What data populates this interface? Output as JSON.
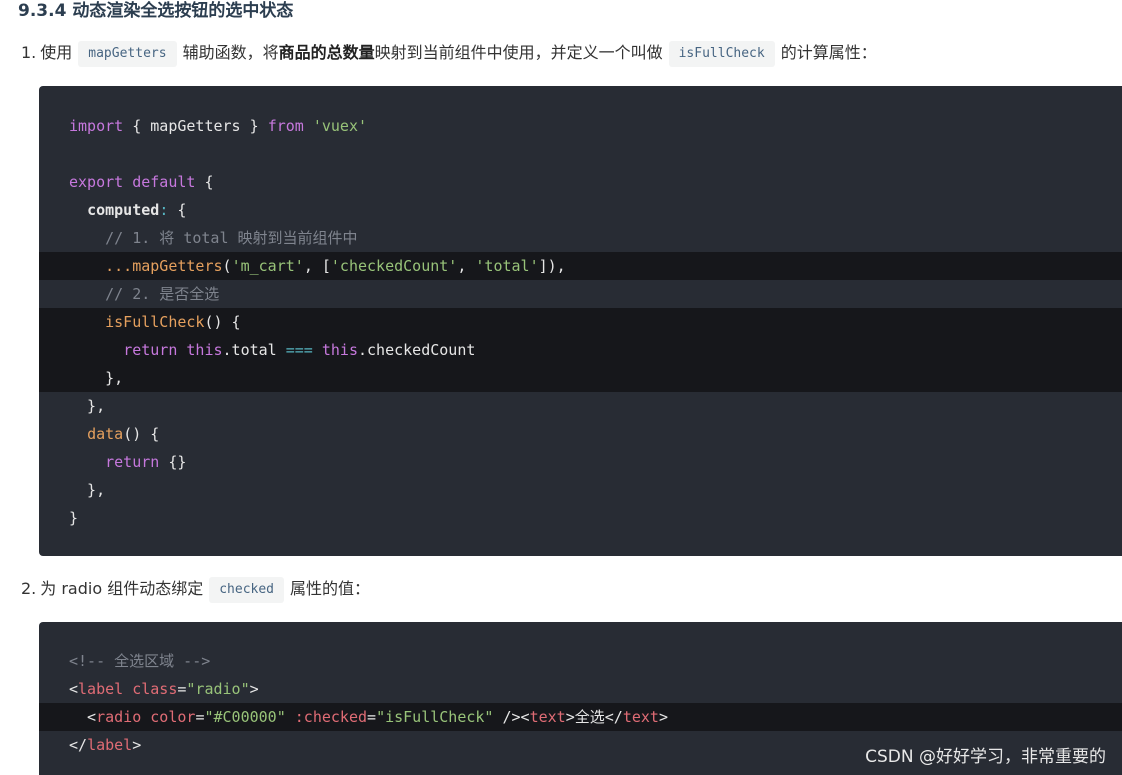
{
  "heading": "9.3.4 动态渲染全选按钮的选中状态",
  "step1": {
    "num": "1.",
    "t1": "使用",
    "code1": "mapGetters",
    "t2": "辅助函数，将",
    "bold": "商品的总数量",
    "t3": "映射到当前组件中使用，并定义一个叫做",
    "code2": "isFullCheck",
    "t4": "的计算属性："
  },
  "code1": {
    "l1": {
      "a": "import",
      "b": " { mapGetters } ",
      "c": "from",
      "d": " ",
      "e": "'vuex'"
    },
    "l3": {
      "a": "export",
      "b": " ",
      "c": "default",
      "d": " {"
    },
    "l4": {
      "a": "  ",
      "b": "computed",
      "c": ":",
      "d": " {"
    },
    "l5": {
      "a": "    // 1. 将 total 映射到当前组件中"
    },
    "l6": {
      "a": "    ",
      "b": "...",
      "c": "mapGetters",
      "d": "(",
      "e": "'m_cart'",
      "f": ", [",
      "g": "'checkedCount'",
      "h": ", ",
      "i": "'total'",
      "j": "]),"
    },
    "l7": {
      "a": "    // 2. 是否全选"
    },
    "l8": {
      "a": "    ",
      "b": "isFullCheck",
      "c": "() {"
    },
    "l9": {
      "a": "      ",
      "b": "return",
      "c": " ",
      "d": "this",
      "e": ".total ",
      "f": "===",
      "g": " ",
      "h": "this",
      "i": ".checkedCount"
    },
    "l10": {
      "a": "    },"
    },
    "l11": {
      "a": "  },"
    },
    "l12": {
      "a": "  ",
      "b": "data",
      "c": "() {"
    },
    "l13": {
      "a": "    ",
      "b": "return",
      "c": " {}"
    },
    "l14": {
      "a": "  },"
    },
    "l15": {
      "a": "}"
    }
  },
  "step2": {
    "num": "2.",
    "t1": "为 radio 组件动态绑定",
    "code1": "checked",
    "t2": "属性的值："
  },
  "code2": {
    "l1": {
      "a": "<!-- 全选区域 -->"
    },
    "l2": {
      "a": "<",
      "b": "label",
      "c": " ",
      "d": "class",
      "e": "=",
      "f": "\"radio\"",
      "g": ">"
    },
    "l3": {
      "a": "  <",
      "b": "radio",
      "c": " ",
      "d": "color",
      "e": "=",
      "f": "\"#C00000\"",
      "g": " ",
      "h": ":checked",
      "i": "=",
      "j": "\"isFullCheck\"",
      "k": " /><",
      "l": "text",
      "m": ">全选</",
      "n": "text",
      "o": ">"
    },
    "l4": {
      "a": "</",
      "b": "label",
      "c": ">"
    }
  },
  "watermark": "CSDN @好好学习，非常重要的",
  "colors": {
    "code_bg": "#282c34",
    "code_highlight": "#16171b",
    "keyword": "#c678dd",
    "string": "#98c379",
    "function": "#e5a05e",
    "comment": "#7f848e",
    "tag": "#e06c75",
    "operator": "#56b6c2"
  }
}
